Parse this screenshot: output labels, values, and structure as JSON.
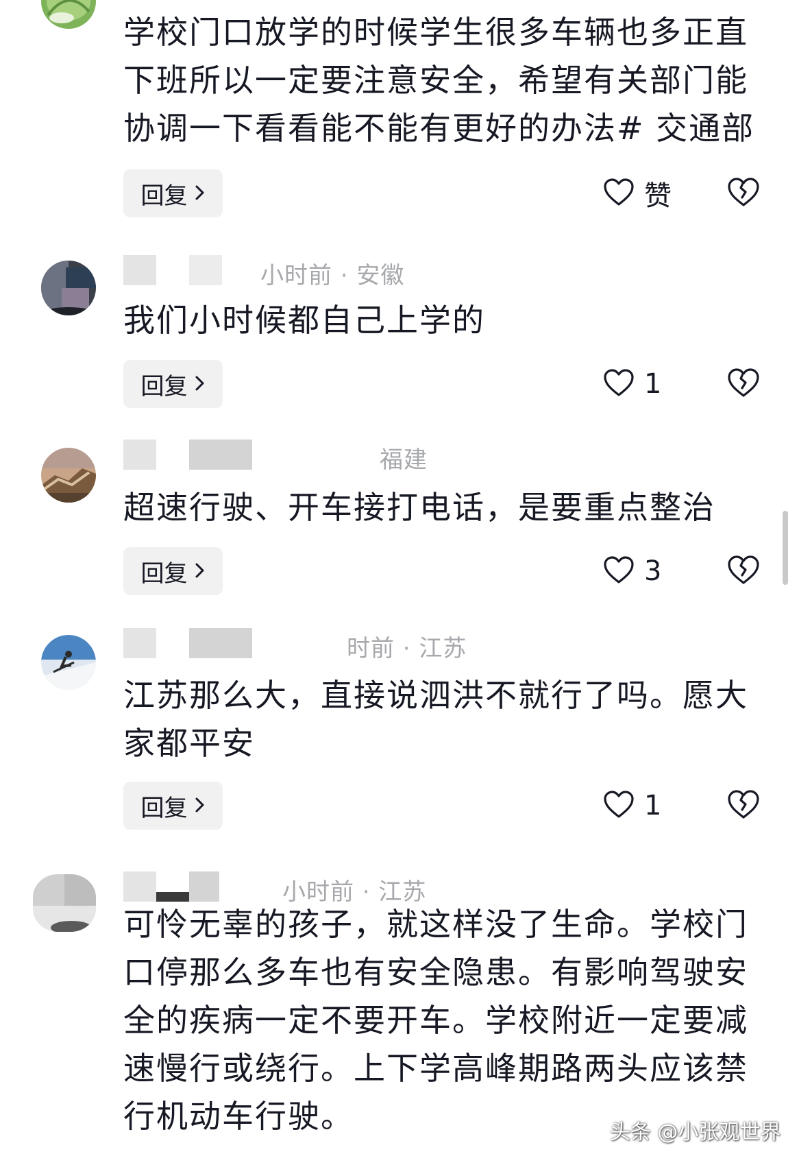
{
  "colors": {
    "text": "#161823",
    "meta": "#a7a8ac",
    "reply_bg": "#f1f1f2"
  },
  "comments": [
    {
      "text": "学校门口放学的时候学生很多车辆也多正直下班所以一定要注意安全，希望有关部门能协调一下看看能不能有更好的办法# 交通部",
      "meta": "",
      "reply_label": "回复",
      "like_label": "赞",
      "avatar_icon": "avatar-green-leaf"
    },
    {
      "text": "我们小时候都自己上学的",
      "meta": "小时前 · 安徽",
      "reply_label": "回复",
      "like_label": "1",
      "avatar_icon": "avatar-blurred-dark"
    },
    {
      "text": "超速行驶、开车接打电话，是要重点整治",
      "meta": "福建",
      "reply_label": "回复",
      "like_label": "3",
      "avatar_icon": "avatar-great-wall"
    },
    {
      "text": "江苏那么大，直接说泗洪不就行了吗。愿大家都平安",
      "meta": "时前 · 江苏",
      "reply_label": "回复",
      "like_label": "1",
      "avatar_icon": "avatar-skier"
    },
    {
      "text": "可怜无辜的孩子，就这样没了生命。学校门口停那么多车也有安全隐患。有影响驾驶安全的疾病一定不要开车。学校附近一定要减速慢行或绕行。上下学高峰期路两头应该禁行机动车行驶。",
      "meta": "小时前 · 江苏",
      "avatar_icon": "avatar-blurred-light"
    }
  ],
  "watermark": "头条 @小张观世界"
}
